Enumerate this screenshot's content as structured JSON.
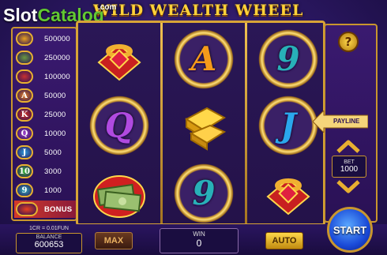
{
  "watermark": {
    "slot": "Slot",
    "catalog": "Catalog",
    "com": ".com"
  },
  "game": {
    "title": "WILD WEALTH WHEEL"
  },
  "paytable": [
    {
      "symbol": "gold-bars",
      "value": "500000",
      "color": "#e8a020"
    },
    {
      "symbol": "cash",
      "value": "250000",
      "color": "#6a9a40"
    },
    {
      "symbol": "ring",
      "value": "100000",
      "color": "#c83030"
    },
    {
      "symbol": "A",
      "value": "50000",
      "color": "#e88020"
    },
    {
      "symbol": "K",
      "value": "25000",
      "color": "#d83020"
    },
    {
      "symbol": "Q",
      "value": "10000",
      "color": "#a040d0"
    },
    {
      "symbol": "J",
      "value": "5000",
      "color": "#30a0e0"
    },
    {
      "symbol": "10",
      "value": "3000",
      "color": "#40c040"
    },
    {
      "symbol": "9",
      "value": "1000",
      "color": "#30b0c0"
    },
    {
      "symbol": "BONUS",
      "value": "BONUS",
      "color": "#e84020"
    }
  ],
  "reels": [
    [
      "ring",
      "Q",
      "cash"
    ],
    [
      "A",
      "gold-bars",
      "9"
    ],
    [
      "9",
      "J",
      "ring"
    ]
  ],
  "controls": {
    "help": "?",
    "payline": "PAYLINE",
    "bet_label": "BET",
    "bet_value": "1000",
    "cr_rate": "1CR = 0.01FUN",
    "balance_label": "BALANCE",
    "balance_value": "600653",
    "max": "MAX",
    "win_label": "WIN",
    "win_value": "0",
    "auto": "AUTO",
    "start": "START"
  },
  "colors": {
    "gold": "#c9962e",
    "start_blue": "#1a4ad8",
    "auto_gold": "#ffd84a"
  }
}
